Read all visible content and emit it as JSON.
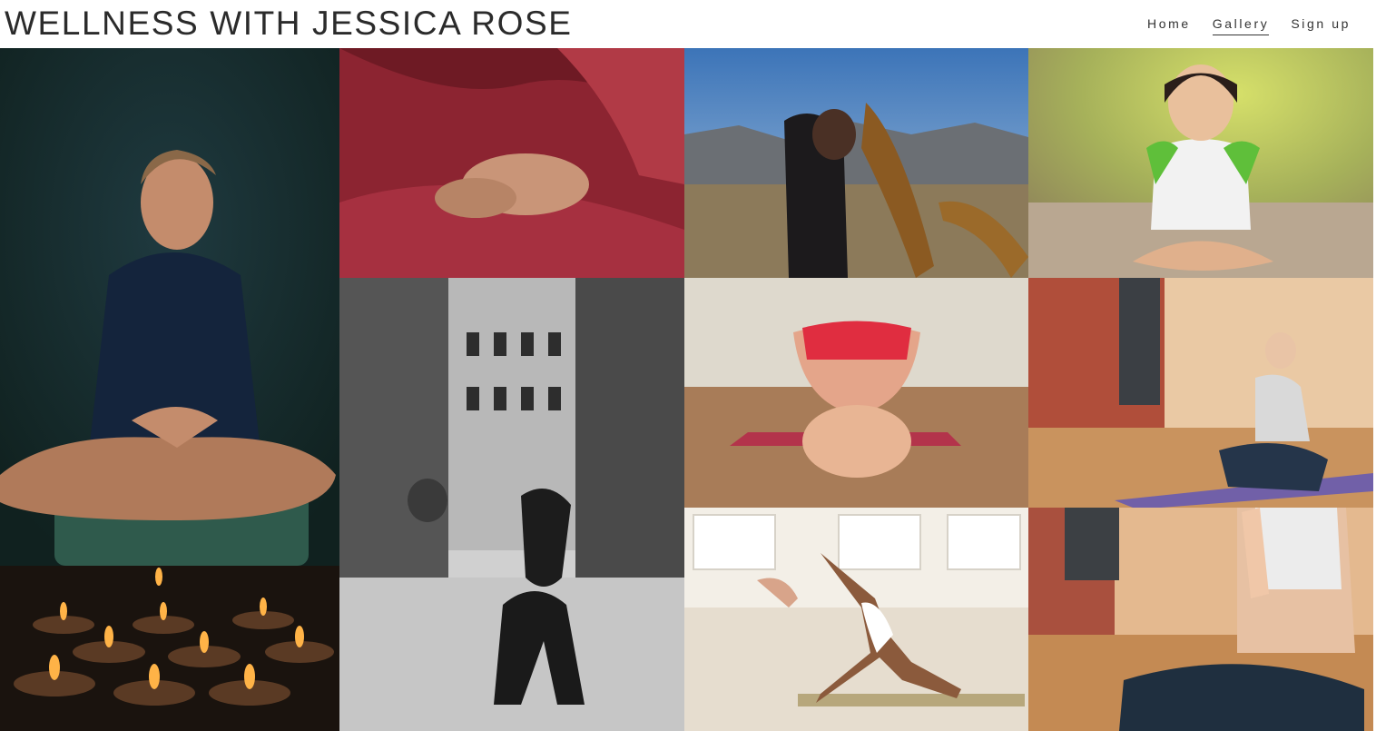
{
  "site": {
    "title": "WELLNESS WITH JESSICA ROSE"
  },
  "nav": {
    "items": [
      {
        "label": "Home",
        "active": false
      },
      {
        "label": "Gallery",
        "active": true
      },
      {
        "label": "Sign up",
        "active": false
      }
    ]
  },
  "gallery": {
    "photos": [
      "man-meditating-photo",
      "hands-red-robe-photo",
      "woman-desert-scarf-photo",
      "child-meditating-photo",
      "bw-street-yoga-photo",
      "forward-fold-photo",
      "seated-meditation-studio-photo",
      "tea-candles-photo",
      "studio-yoga-pose-photo",
      "prayer-hands-photo"
    ]
  }
}
